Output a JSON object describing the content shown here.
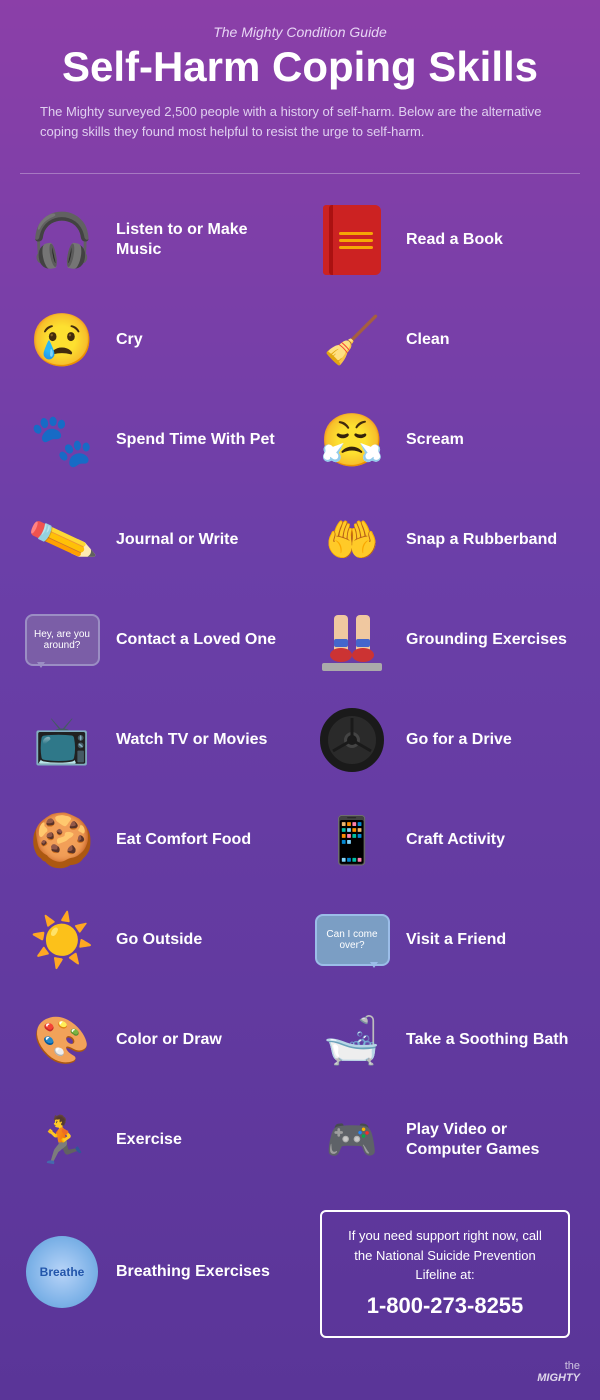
{
  "header": {
    "subtitle": "The Mighty Condition Guide",
    "title": "Self-Harm Coping Skills",
    "description": "The Mighty surveyed 2,500 people with a history of self-harm. Below are the alternative coping skills they found most helpful to resist the urge to self-harm."
  },
  "items": [
    {
      "id": "listen-music",
      "label": "Listen to or Make Music",
      "icon": "headphones",
      "col": 0
    },
    {
      "id": "read-book",
      "label": "Read a Book",
      "icon": "book",
      "col": 1
    },
    {
      "id": "cry",
      "label": "Cry",
      "icon": "cry",
      "col": 0
    },
    {
      "id": "clean",
      "label": "Clean",
      "icon": "broom",
      "col": 1
    },
    {
      "id": "spend-pet",
      "label": "Spend Time With Pet",
      "icon": "pet",
      "col": 0
    },
    {
      "id": "scream",
      "label": "Scream",
      "icon": "scream",
      "col": 1
    },
    {
      "id": "journal",
      "label": "Journal or Write",
      "icon": "pencil",
      "col": 0
    },
    {
      "id": "snap-rubber",
      "label": "Snap a Rubberband",
      "icon": "rubber",
      "col": 1
    },
    {
      "id": "contact-loved",
      "label": "Contact a Loved One",
      "icon": "bubble",
      "col": 0
    },
    {
      "id": "grounding",
      "label": "Grounding Exercises",
      "icon": "grounding",
      "col": 1
    },
    {
      "id": "watch-tv",
      "label": "Watch TV or Movies",
      "icon": "tv",
      "col": 0
    },
    {
      "id": "drive",
      "label": "Go for a Drive",
      "icon": "steering",
      "col": 1
    },
    {
      "id": "comfort-food",
      "label": "Eat Comfort Food",
      "icon": "cookie",
      "col": 0
    },
    {
      "id": "craft",
      "label": "Craft Activity",
      "icon": "craft",
      "col": 1
    },
    {
      "id": "go-outside",
      "label": "Go Outside",
      "icon": "sun",
      "col": 0
    },
    {
      "id": "visit-friend",
      "label": "Visit a Friend",
      "icon": "visit",
      "col": 1
    },
    {
      "id": "color-draw",
      "label": "Color or Draw",
      "icon": "draw",
      "col": 0
    },
    {
      "id": "bath",
      "label": "Take a Soothing Bath",
      "icon": "bath",
      "col": 1
    },
    {
      "id": "exercise",
      "label": "Exercise",
      "icon": "exercise",
      "col": 0
    },
    {
      "id": "video-games",
      "label": "Play Video or Computer Games",
      "icon": "games",
      "col": 1
    },
    {
      "id": "breathing",
      "label": "Breathing Exercises",
      "icon": "breathe",
      "col": 0
    }
  ],
  "lifeline": {
    "text": "If you need support right now, call the National Suicide Prevention Lifeline at:",
    "number": "1-800-273-8255"
  },
  "footer": {
    "logo": "the MIGHTY"
  },
  "bubbleTexts": {
    "contact": "Hey, are you around?",
    "visit": "Can I come over?",
    "breathe": "Breathe"
  }
}
